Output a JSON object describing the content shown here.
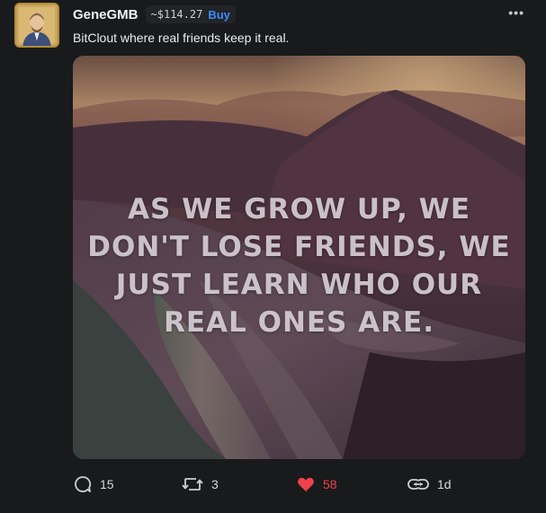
{
  "post": {
    "username": "GeneGMB",
    "price": "~$114.27",
    "buy_label": "Buy",
    "more_label": "•••",
    "body": "BitClout where real friends keep it real.",
    "image_quote_lines": [
      "AS WE GROW UP, WE",
      "DON'T LOSE FRIENDS, WE",
      "JUST LEARN WHO OUR",
      "REAL ONES ARE."
    ]
  },
  "actions": {
    "comments": {
      "icon": "comment-icon",
      "count": "15"
    },
    "reclouts": {
      "icon": "repost-icon",
      "count": "3"
    },
    "likes": {
      "icon": "heart-icon",
      "count": "58",
      "color": "#f0424a"
    },
    "link": {
      "icon": "link-icon",
      "time": "1d"
    }
  },
  "colors": {
    "background": "#191a1c",
    "buy": "#3d8bff",
    "like": "#f0424a"
  }
}
